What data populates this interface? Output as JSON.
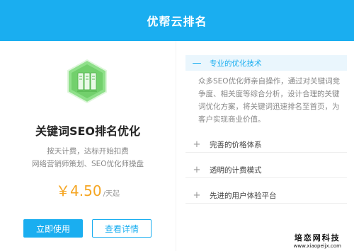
{
  "header": {
    "title": "优帮云排名"
  },
  "product": {
    "icon": "server-icon",
    "title": "关键词SEO排名优化",
    "desc_line1": "按天计费，达标开始扣费",
    "desc_line2": "网络营销师策划、SEO优化师操盘",
    "price": "￥4.50",
    "price_unit": "/天起",
    "price_color": "#f5a623"
  },
  "buttons": {
    "use_now": "立即使用",
    "view_details": "查看详情"
  },
  "accordion": {
    "items": [
      {
        "label": "专业的优化技术",
        "icon": "minus-icon",
        "expanded": true,
        "body": "众多SEO优化师亲自操作，通过对关键词竞争度、相关度等综合分析，设计合理的关键词优化方案，将关键词迅速排名至首页，为客户实现商业价值。"
      },
      {
        "label": "完善的价格体系",
        "icon": "plus-icon",
        "expanded": false
      },
      {
        "label": "透明的计费模式",
        "icon": "plus-icon",
        "expanded": false
      },
      {
        "label": "先进的用户体验平台",
        "icon": "plus-icon",
        "expanded": false
      }
    ]
  },
  "watermark": {
    "line1": "培恋网科技",
    "line2": "www.xiaopeijx.com"
  },
  "colors": {
    "accent": "#1aaef0",
    "icon_green": "#6fd36b"
  }
}
